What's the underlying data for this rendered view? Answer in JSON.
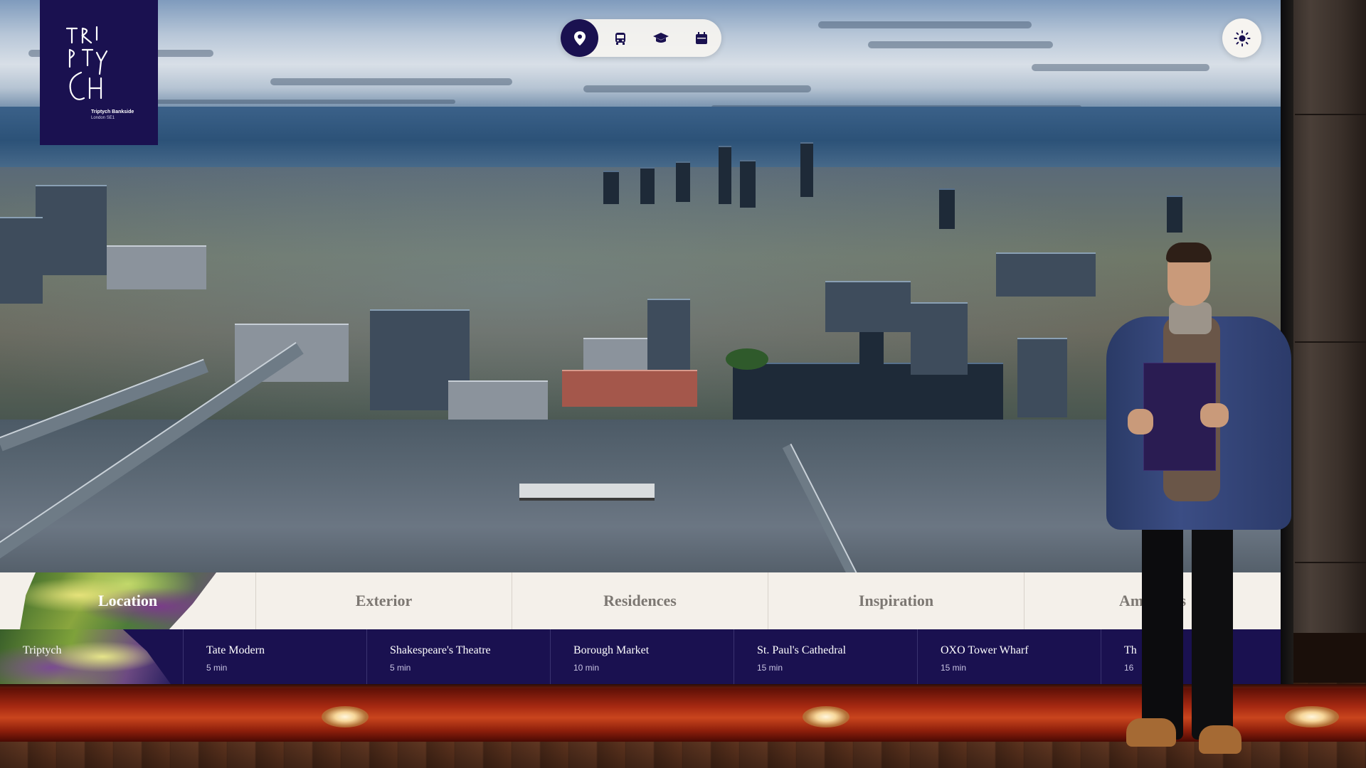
{
  "brand": {
    "name": "Triptych Bankside",
    "address": "London SE1",
    "logo_letters": [
      "T",
      "R",
      "I",
      "P",
      "T",
      "Y",
      "C",
      "H"
    ],
    "color": "#1a1150"
  },
  "top_nav": {
    "items": [
      {
        "icon": "location-pin-icon",
        "active": true
      },
      {
        "icon": "bus-icon",
        "active": false
      },
      {
        "icon": "graduation-cap-icon",
        "active": false
      },
      {
        "icon": "calendar-icon",
        "active": false
      }
    ]
  },
  "theme_toggle": {
    "icon": "sun-icon"
  },
  "tabs": [
    {
      "label": "Location",
      "active": true
    },
    {
      "label": "Exterior",
      "active": false
    },
    {
      "label": "Residences",
      "active": false
    },
    {
      "label": "Inspiration",
      "active": false
    },
    {
      "label": "Amenities",
      "active": false
    }
  ],
  "destinations": [
    {
      "name": "Triptych",
      "time": ""
    },
    {
      "name": "Tate Modern",
      "time": "5 min"
    },
    {
      "name": "Shakespeare's Theatre",
      "time": "5 min"
    },
    {
      "name": "Borough Market",
      "time": "10 min"
    },
    {
      "name": "St. Paul's Cathedral",
      "time": "15 min"
    },
    {
      "name": "OXO Tower Wharf",
      "time": "15 min"
    },
    {
      "name": "Th",
      "time": "16"
    }
  ],
  "colors": {
    "accent": "#1a1150",
    "tab_bg": "#f4f0ea",
    "tab_text": "#7c7772"
  }
}
